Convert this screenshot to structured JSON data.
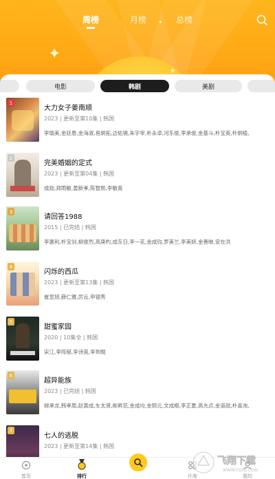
{
  "header": {
    "tabs": [
      "周榜",
      "月榜",
      "总榜"
    ],
    "active_tab": 0,
    "search_icon": "search-icon"
  },
  "categories": [
    "电影",
    "韩剧",
    "美剧"
  ],
  "active_category": 1,
  "items": [
    {
      "rank": "1",
      "title": "大力女子姜南顺",
      "meta": "2023 | 更新至第10集 | 韩国",
      "cast": "李瑜美,金廷恩,金海淑,邕炯拓,边佑锡,朱宇宰,朴永卓,河东俊,李承俊,金基斗,朴宝英,朴炯植,"
    },
    {
      "rank": "2",
      "title": "完美婚姻的定式",
      "meta": "2023 | 更新至第04集 | 韩国",
      "cast": "成勋,郑雨敏,姜新孝,陈智熙,李敏英"
    },
    {
      "rank": "3",
      "title": "请回答1988",
      "meta": "2015 | 已完结 | 韩国",
      "cast": "李惠利,朴宝剑,柳俊烈,高庚杓,成东日,李一花,金成钧,罗美兰,李美妍,金善映,安在洪"
    },
    {
      "rank": "4",
      "title": "闪烁的西瓜",
      "meta": "2023 | 更新至第13集 | 韩国",
      "cast": "崔显旭,薛仁雅,厉云,申银秀"
    },
    {
      "rank": "5",
      "title": "甜蜜家园",
      "meta": "2020 | 10集全 | 韩国",
      "cast": "宋江,李阵郁,李诗英,李到晛"
    },
    {
      "rank": "6",
      "title": "超异能族",
      "meta": "2023 | 已完结 | 韩国",
      "cast": "柳承龙,韩孝周,赵寅成,车太贤,柳昇范,金成均,金熙元,文成根,李正夏,高允贞,金道勋,朴喜洵,"
    },
    {
      "rank": "7",
      "title": "七人的逃脱",
      "meta": "2023 | 更新至第14集 | 韩国",
      "cast": ""
    }
  ],
  "bottom_nav": [
    {
      "label": "首页",
      "icon": "home-icon"
    },
    {
      "label": "排行",
      "icon": "ranking-medal-icon"
    },
    {
      "label": "",
      "icon": "search-icon"
    },
    {
      "label": "片库",
      "icon": "library-icon"
    },
    {
      "label": "我的",
      "icon": "profile-icon"
    }
  ],
  "active_nav": 1,
  "watermark": {
    "text": "飞翔下载",
    "sub": "WWW.FXXZ.COM"
  },
  "colors": {
    "header": "#ffa915",
    "accent": "#ffc91e",
    "active_category_bg": "#1d1d1d"
  }
}
